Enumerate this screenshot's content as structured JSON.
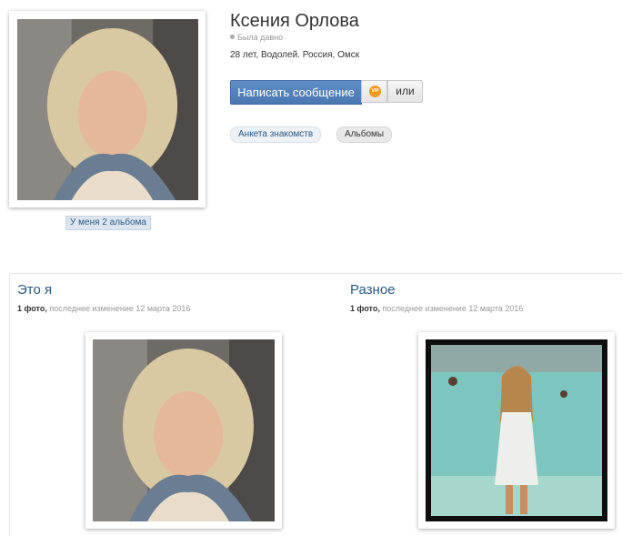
{
  "profile": {
    "name": "Ксения Орлова",
    "status": "Была давно",
    "meta": "28 лет, Водолей. Россия, Омск",
    "albums_link": "У меня 2 альбома"
  },
  "actions": {
    "message_label": "Написать сообщение",
    "vip_label": "VIP",
    "or_label": "или"
  },
  "tabs": [
    "Анкета знакомств",
    "Альбомы"
  ],
  "albums": [
    {
      "title": "Это я",
      "count": "1 фото,",
      "updated": "последнее изменение 12 марта 2016"
    },
    {
      "title": "Разное",
      "count": "1 фото,",
      "updated": "последнее изменение 12 марта 2016"
    }
  ]
}
